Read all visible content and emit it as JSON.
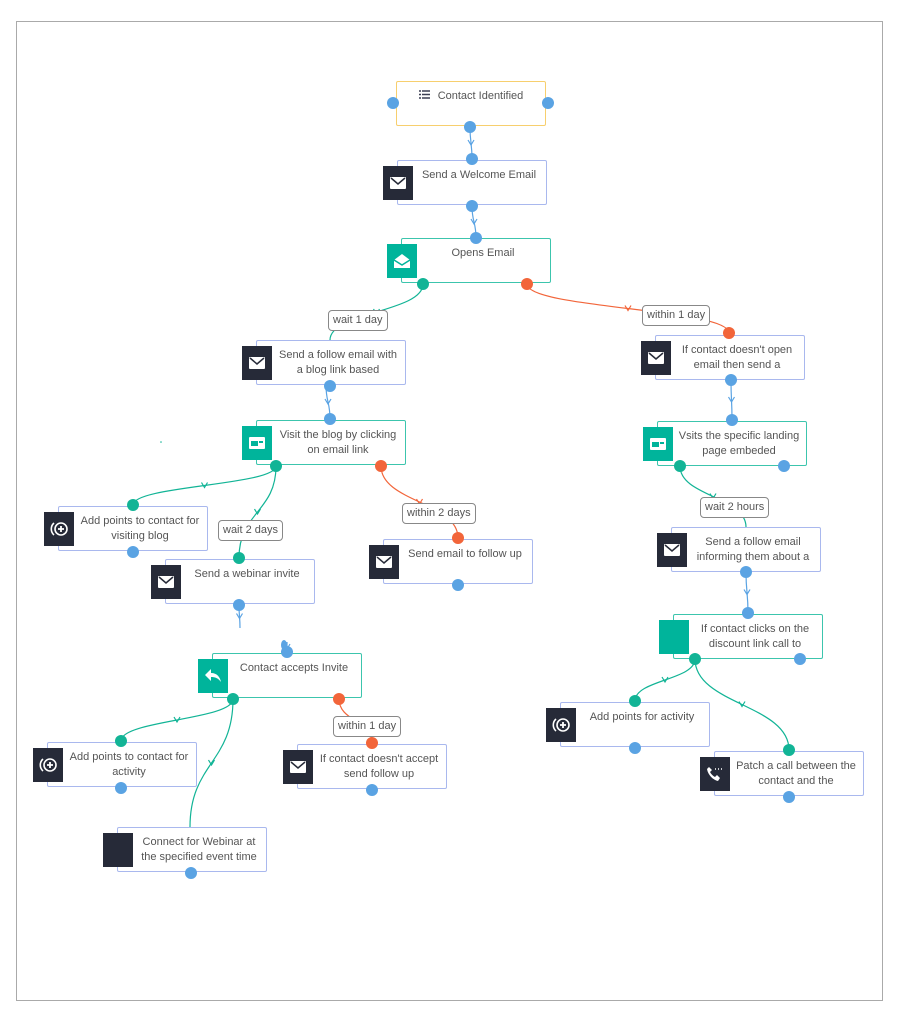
{
  "colors": {
    "action_border": "#a9b8ee",
    "trigger_border": "#f7cf6e",
    "condition_border": "#3cc5ad",
    "icon_dark": "#262a38",
    "icon_teal": "#00b49b",
    "port_blue": "#5aa3e3",
    "port_green": "#12b496",
    "port_red": "#f2653a"
  },
  "nodes": [
    {
      "id": "n1",
      "label": "Contact Identified",
      "kind": "trigger",
      "icon": "list-icon"
    },
    {
      "id": "n2",
      "label": "Send a Welcome Email",
      "kind": "action",
      "icon": "email-icon"
    },
    {
      "id": "n3",
      "label": "Opens Email",
      "kind": "condition",
      "icon": "open-email-icon"
    },
    {
      "id": "n4",
      "label": "Send a follow email with a blog link based",
      "kind": "action",
      "icon": "email-icon"
    },
    {
      "id": "n5",
      "label": "If contact doesn't open email then send a",
      "kind": "action",
      "icon": "email-icon"
    },
    {
      "id": "n6",
      "label": "Visit the blog by clicking on email link",
      "kind": "condition",
      "icon": "webpage-icon"
    },
    {
      "id": "n7",
      "label": "Vsits the specific landing page embeded",
      "kind": "condition",
      "icon": "webpage-icon"
    },
    {
      "id": "n8",
      "label": "Add points to contact for visiting blog",
      "kind": "action",
      "icon": "add-points-icon"
    },
    {
      "id": "n9",
      "label": "Send a webinar invite",
      "kind": "action",
      "icon": "email-icon"
    },
    {
      "id": "n10",
      "label": "Send email to follow up",
      "kind": "action",
      "icon": "email-icon"
    },
    {
      "id": "n11",
      "label": "Send a follow email informing them about a",
      "kind": "action",
      "icon": "email-icon"
    },
    {
      "id": "n12",
      "label": "If contact clicks on the discount link call to",
      "kind": "condition",
      "icon": "blank-icon"
    },
    {
      "id": "n13",
      "label": "Contact accepts Invite",
      "kind": "condition",
      "icon": "reply-icon"
    },
    {
      "id": "n14",
      "label": "Add points for activity",
      "kind": "action",
      "icon": "add-points-icon"
    },
    {
      "id": "n15",
      "label": "Add points to contact for activity",
      "kind": "action",
      "icon": "add-points-icon"
    },
    {
      "id": "n16",
      "label": "If contact doesn't accept send follow up",
      "kind": "action",
      "icon": "email-icon"
    },
    {
      "id": "n17",
      "label": "Patch a call between the contact and the",
      "kind": "action",
      "icon": "phone-call-icon"
    },
    {
      "id": "n18",
      "label": "Connect for Webinar at the specified event time",
      "kind": "action",
      "icon": "blank-icon"
    }
  ],
  "edge_labels": [
    "wait 1 day",
    "within 1 day",
    "wait 2 days",
    "within 2 days",
    "wait 2 hours",
    "within 1 day"
  ]
}
